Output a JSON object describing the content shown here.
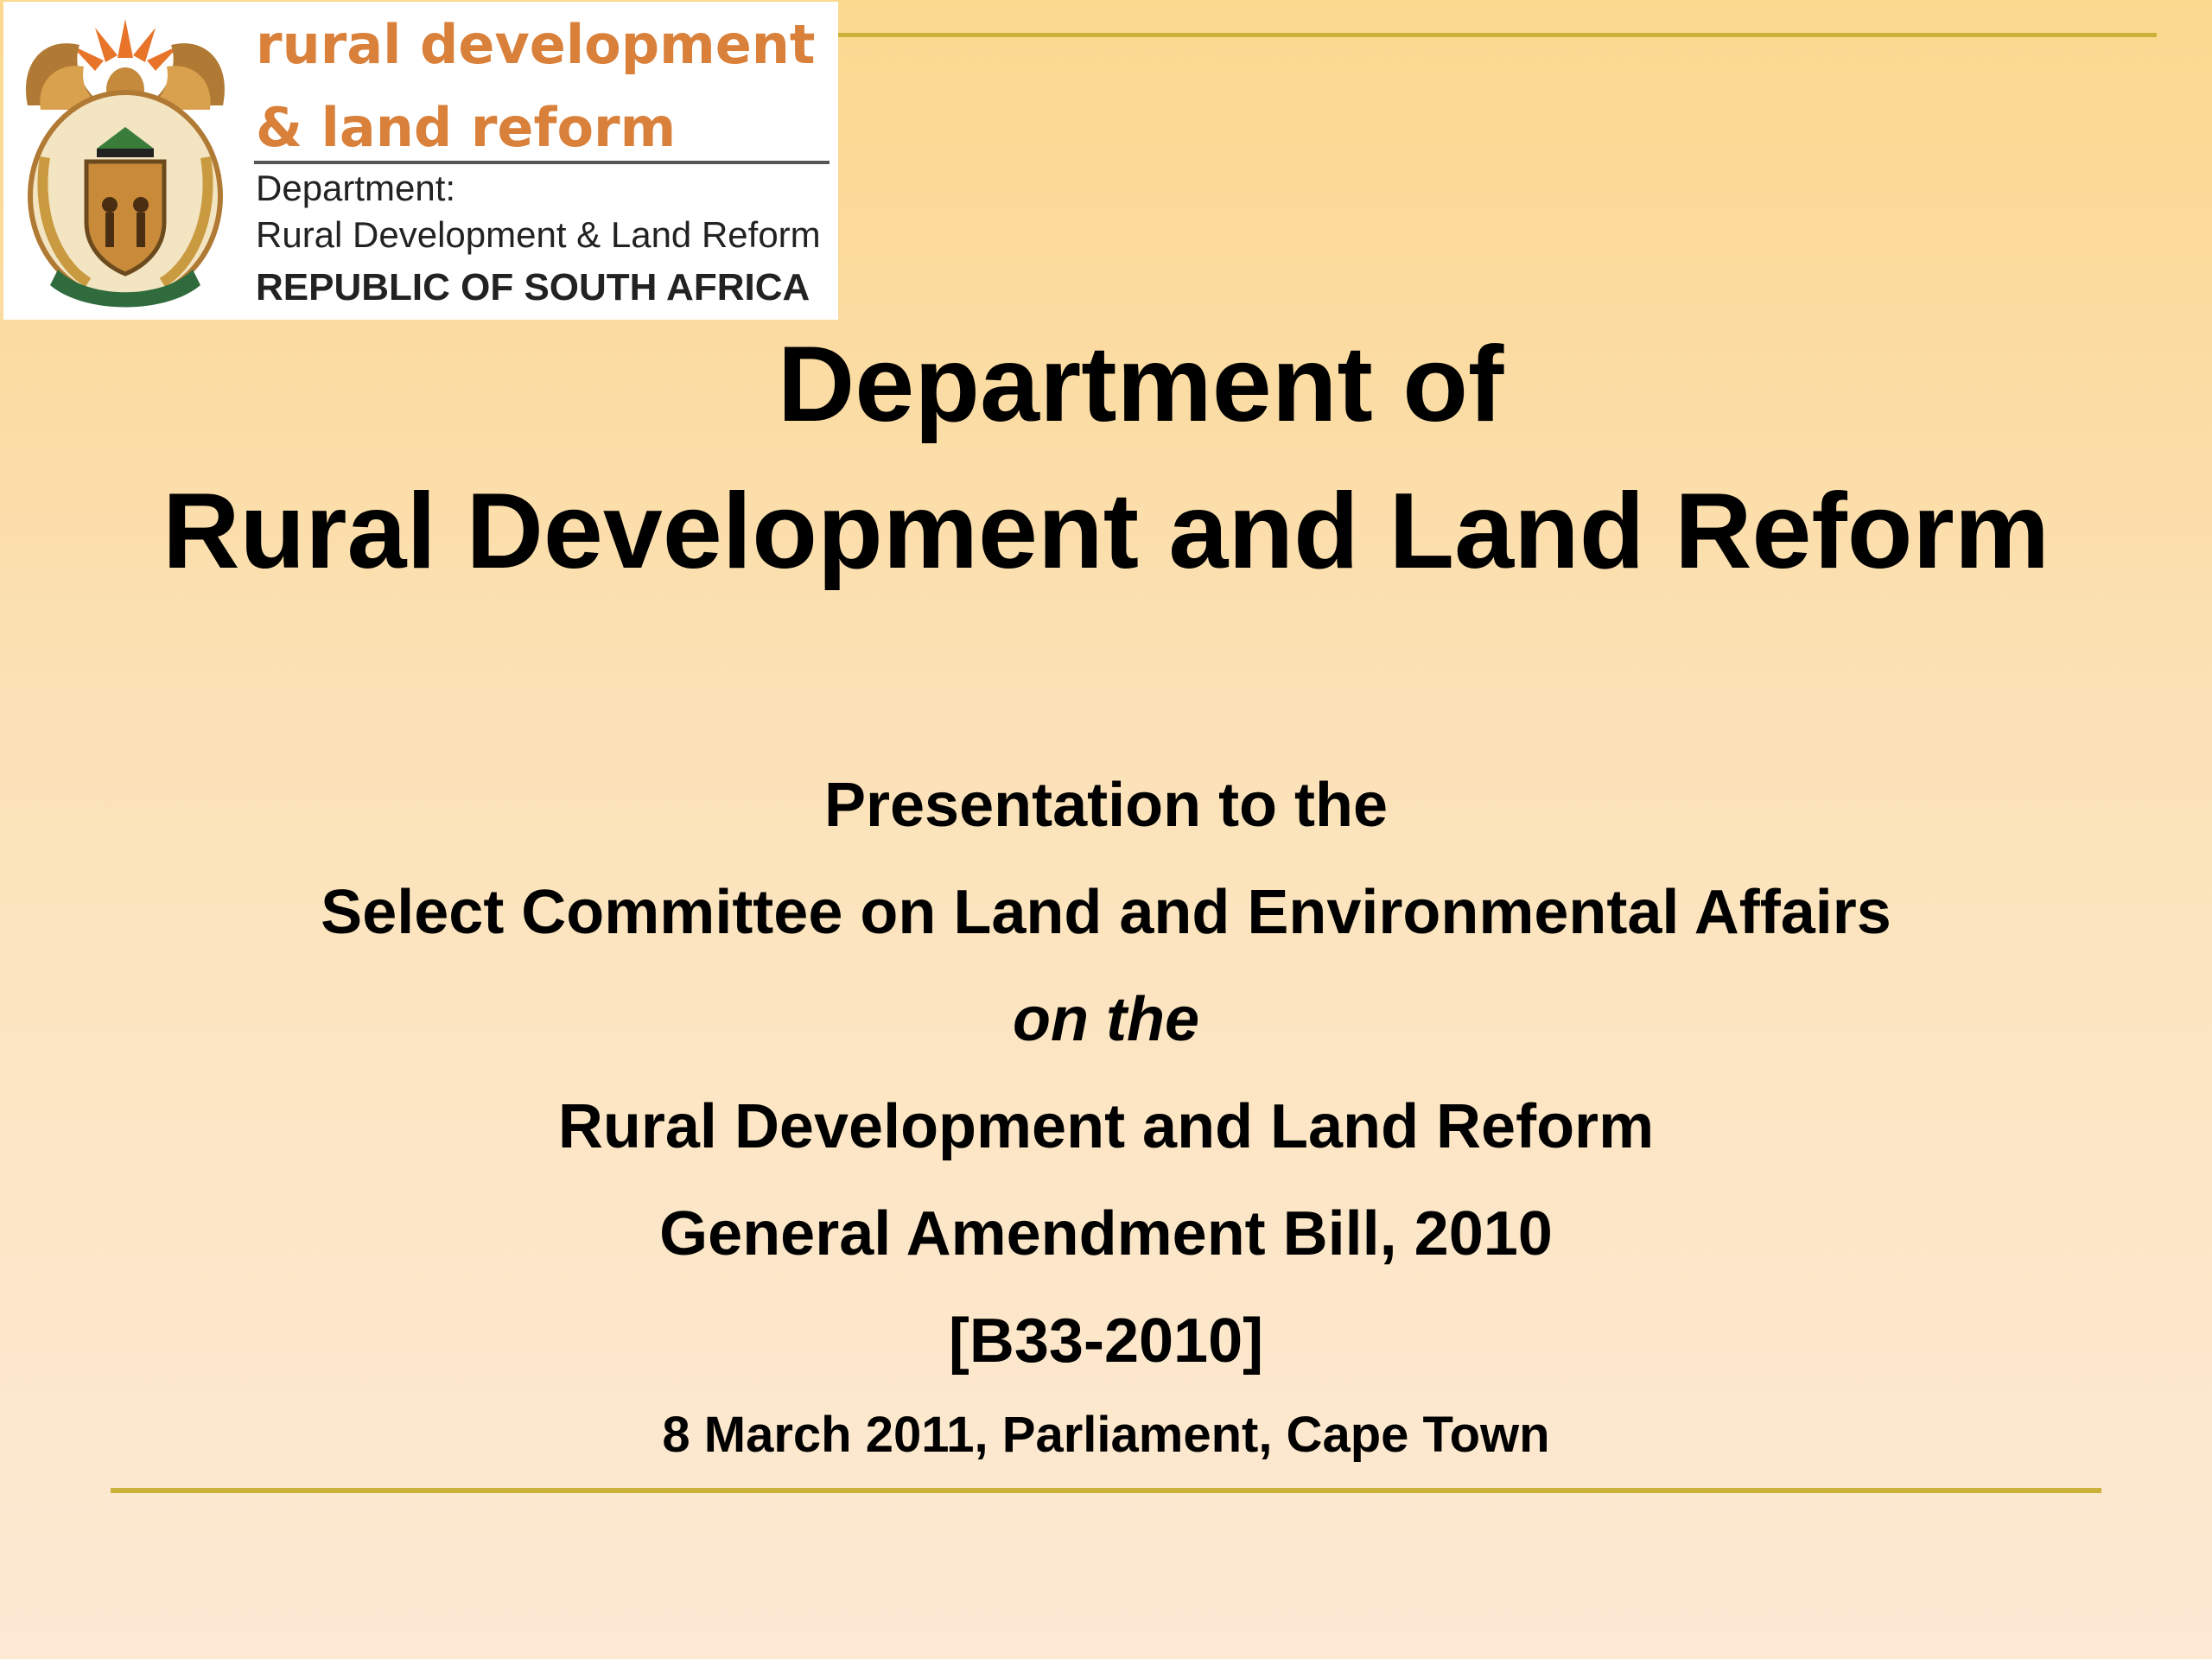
{
  "logo": {
    "wordmark_line1": "rural development",
    "wordmark_line2": "& land reform",
    "department_label": "Department:",
    "department_name": "Rural Development & Land Reform",
    "country": "REPUBLIC OF SOUTH AFRICA",
    "crest_icon": "coat-of-arms-icon",
    "wordmark_color": "#d9803a"
  },
  "title": {
    "line1": "Department of",
    "line2": "Rural Development and Land Reform"
  },
  "subtitle": {
    "line1": "Presentation to the",
    "line2": "Select Committee on Land and Environmental Affairs",
    "line3": "on the",
    "line4": "Rural Development and Land Reform",
    "line5": "General Amendment Bill, 2010",
    "line6": "[B33-2010]",
    "date_line": "8 March 2011, Parliament, Cape Town"
  },
  "colors": {
    "accent_rule": "#c9b13a",
    "background_top": "#fbd98f",
    "background_bottom": "#fde9d4"
  }
}
